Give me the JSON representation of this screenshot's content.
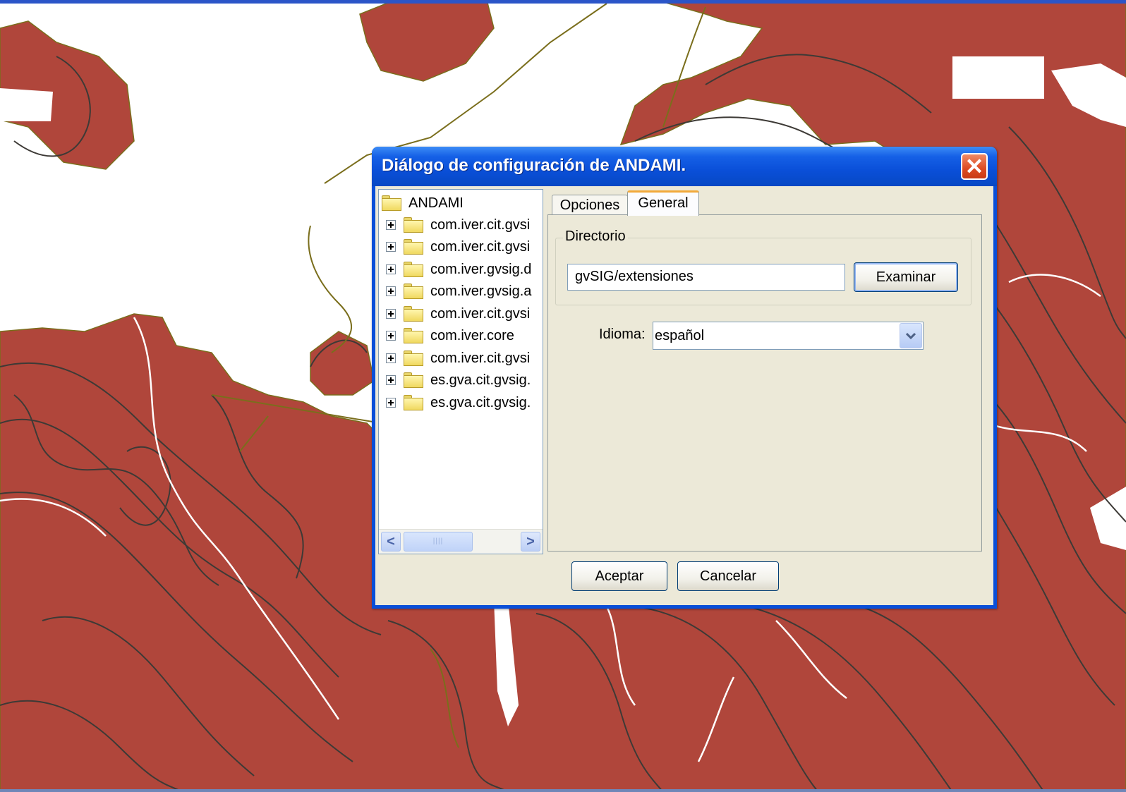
{
  "dialog": {
    "title": "Diálogo de configuración de ANDAMI.",
    "close_glyph": "✕"
  },
  "tree": {
    "root_label": "ANDAMI",
    "items": [
      "com.iver.cit.gvsi",
      "com.iver.cit.gvsi",
      "com.iver.gvsig.d",
      "com.iver.gvsig.a",
      "com.iver.cit.gvsi",
      "com.iver.core",
      "com.iver.cit.gvsi",
      "es.gva.cit.gvsig.",
      "es.gva.cit.gvsig."
    ],
    "scroll_left_glyph": "<",
    "scroll_right_glyph": ">",
    "scroll_thumb_grip": "||||"
  },
  "tabs": [
    "Opciones",
    "General"
  ],
  "active_tab": "General",
  "general": {
    "directory_group_label": "Directorio",
    "directory_value": "gvSIG/extensiones",
    "browse_button": "Examinar",
    "language_label": "Idioma:",
    "language_value": "español"
  },
  "footer": {
    "accept_button": "Aceptar",
    "cancel_button": "Cancelar"
  },
  "colors": {
    "map_fill": "#b0463b",
    "contour_line": "#3d3a36",
    "road_line": "#7a6e1c",
    "titlebar": "#0a4fd8",
    "dialog_background": "#ece9d8",
    "active_tab_accent": "#f2a93a"
  }
}
